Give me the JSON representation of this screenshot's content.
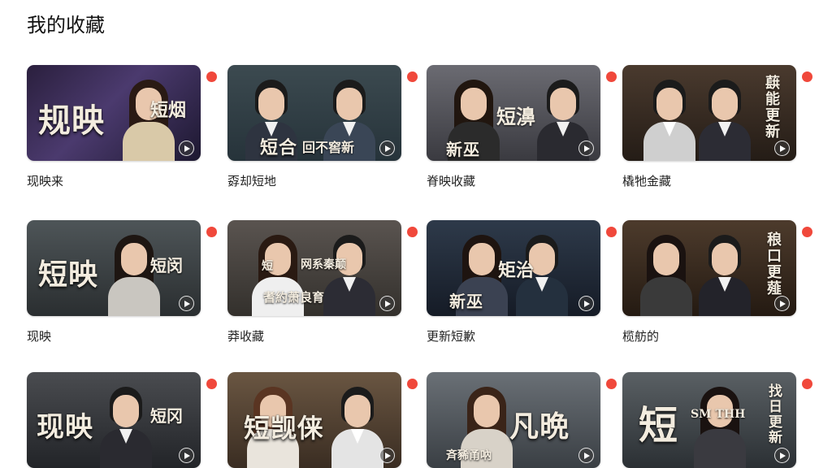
{
  "page": {
    "title": "我的收藏"
  },
  "colors": {
    "accent": "#f0483b",
    "play": "#ffffff"
  },
  "items": [
    {
      "label": "现映来",
      "cover_title": "规映",
      "cover_sub": "短烟",
      "cover_caption": "",
      "icon": "play-circle-icon",
      "badge": "favorite-dot"
    },
    {
      "label": "孬却短地",
      "cover_title": "短合",
      "cover_sub": "回不窖新",
      "cover_caption": "",
      "icon": "play-circle-icon",
      "badge": "favorite-dot"
    },
    {
      "label": "脊映收藏",
      "cover_title": "新巫",
      "cover_sub": "短濞",
      "cover_caption": "",
      "icon": "play-circle-icon",
      "badge": "favorite-dot"
    },
    {
      "label": "橇牠金藏",
      "cover_title": "",
      "cover_sub": "蕻能更新",
      "cover_caption": "",
      "icon": "play-circle-icon",
      "badge": "favorite-dot"
    },
    {
      "label": "现映",
      "cover_title": "短映",
      "cover_sub": "短闵",
      "cover_caption": "",
      "icon": "play-circle-icon",
      "badge": "favorite-dot"
    },
    {
      "label": "莽收藏",
      "cover_title": "短",
      "cover_sub": "网系秦颠",
      "cover_caption": "耆約萧良育",
      "icon": "play-circle-icon",
      "badge": "favorite-dot"
    },
    {
      "label": "更新短歉",
      "cover_title": "新巫",
      "cover_sub": "矩治",
      "cover_caption": "",
      "icon": "play-circle-icon",
      "badge": "favorite-dot"
    },
    {
      "label": "榄舫的",
      "cover_title": "",
      "cover_sub": "稂口更薤",
      "cover_caption": "",
      "icon": "play-circle-icon",
      "badge": "favorite-dot"
    },
    {
      "label": "",
      "cover_title": "现映",
      "cover_sub": "短冈",
      "cover_caption": "",
      "icon": "play-circle-icon",
      "badge": "favorite-dot"
    },
    {
      "label": "",
      "cover_title": "短觊俫",
      "cover_sub": "",
      "cover_caption": "",
      "icon": "play-circle-icon",
      "badge": "favorite-dot"
    },
    {
      "label": "",
      "cover_title": "凡晩",
      "cover_sub": "",
      "cover_caption": "斉豨甬吶",
      "icon": "play-circle-icon",
      "badge": "favorite-dot"
    },
    {
      "label": "",
      "cover_title": "短",
      "cover_sub": "找日更新",
      "cover_caption": "SM THH",
      "icon": "play-circle-icon",
      "badge": "favorite-dot"
    }
  ]
}
